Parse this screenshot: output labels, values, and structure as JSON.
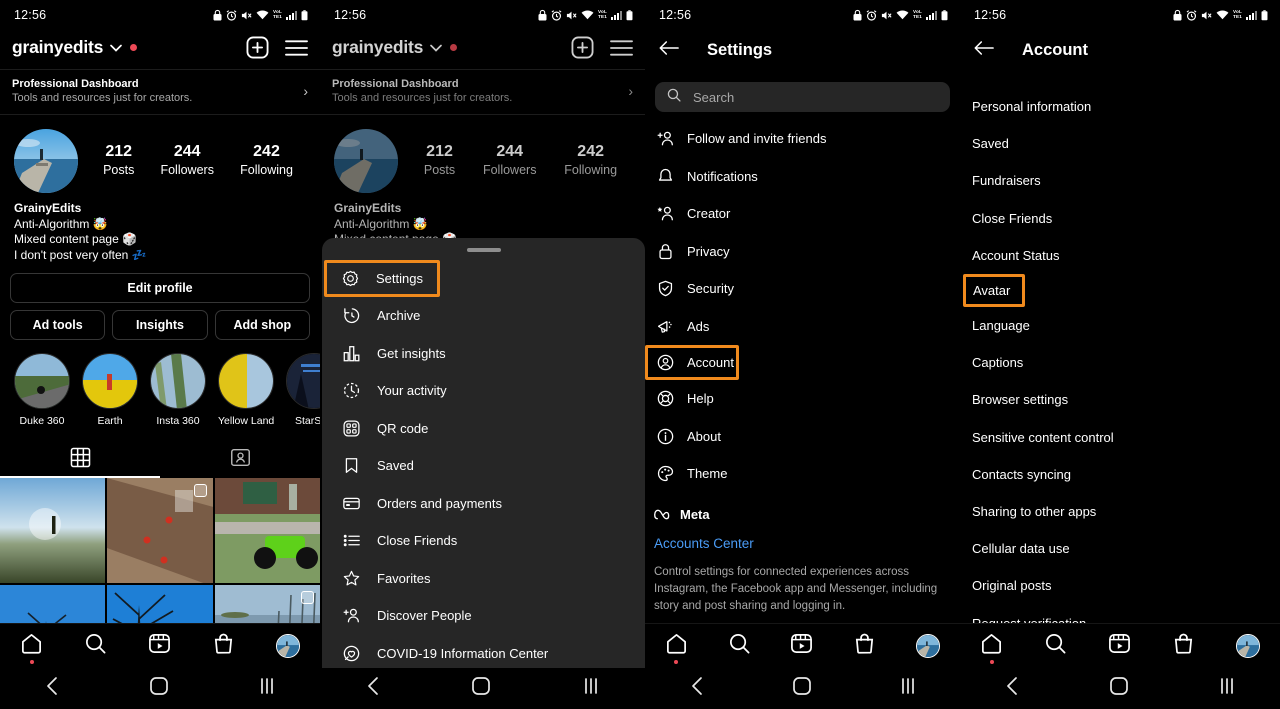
{
  "status_bar": {
    "time": "12:56",
    "icons": [
      "lock-icon",
      "alarm-icon",
      "mute-icon",
      "wifi-icon",
      "volte-icon",
      "signal-icon",
      "battery-icon"
    ],
    "volte_label": "VoLTE1"
  },
  "colors": {
    "highlight_orange": "#F08A1D",
    "link_blue": "#4A9CF6",
    "badge_red": "#ED4956",
    "drawer_bg": "#262626",
    "page_bg": "#000000"
  },
  "profile": {
    "username": "grainyedits",
    "pro_dashboard": {
      "title": "Professional Dashboard",
      "subtitle": "Tools and resources just for creators."
    },
    "stats": [
      {
        "value": "212",
        "label": "Posts"
      },
      {
        "value": "244",
        "label": "Followers"
      },
      {
        "value": "242",
        "label": "Following"
      }
    ],
    "bio": {
      "name": "GrainyEdits",
      "line1": "Anti-Algorithm 🤯",
      "line2": "Mixed content page 🎲",
      "line3": "I don't post very often 💤"
    },
    "buttons": {
      "edit_profile": "Edit profile",
      "ad_tools": "Ad tools",
      "insights": "Insights",
      "add_shop": "Add shop"
    },
    "highlights": [
      {
        "label": "Duke 360"
      },
      {
        "label": "Earth"
      },
      {
        "label": "Insta 360"
      },
      {
        "label": "Yellow Land"
      },
      {
        "label": "StarSha"
      }
    ],
    "tabs": [
      {
        "icon": "grid-icon",
        "active": true
      },
      {
        "icon": "tagged-icon",
        "active": false
      }
    ]
  },
  "drawer": {
    "items": [
      {
        "label": "Settings",
        "icon": "settings-gear-icon",
        "highlighted": true
      },
      {
        "label": "Archive",
        "icon": "archive-clock-icon",
        "highlighted": false
      },
      {
        "label": "Get insights",
        "icon": "bar-chart-icon",
        "highlighted": false
      },
      {
        "label": "Your activity",
        "icon": "activity-clock-icon",
        "highlighted": false
      },
      {
        "label": "QR code",
        "icon": "qr-code-icon",
        "highlighted": false
      },
      {
        "label": "Saved",
        "icon": "bookmark-icon",
        "highlighted": false
      },
      {
        "label": "Orders and payments",
        "icon": "card-icon",
        "highlighted": false
      },
      {
        "label": "Close Friends",
        "icon": "list-icon",
        "highlighted": false
      },
      {
        "label": "Favorites",
        "icon": "star-icon",
        "highlighted": false
      },
      {
        "label": "Discover People",
        "icon": "add-person-icon",
        "highlighted": false
      },
      {
        "label": "COVID-19 Information Center",
        "icon": "covid-heart-icon",
        "highlighted": false
      }
    ]
  },
  "settings": {
    "title": "Settings",
    "search_placeholder": "Search",
    "items": [
      {
        "label": "Follow and invite friends",
        "icon": "add-person-icon",
        "highlighted": false
      },
      {
        "label": "Notifications",
        "icon": "bell-icon",
        "highlighted": false
      },
      {
        "label": "Creator",
        "icon": "star-person-icon",
        "highlighted": false
      },
      {
        "label": "Privacy",
        "icon": "lock-icon",
        "highlighted": false
      },
      {
        "label": "Security",
        "icon": "shield-check-icon",
        "highlighted": false
      },
      {
        "label": "Ads",
        "icon": "megaphone-icon",
        "highlighted": false
      },
      {
        "label": "Account",
        "icon": "account-circle-icon",
        "highlighted": true
      },
      {
        "label": "Help",
        "icon": "lifebuoy-icon",
        "highlighted": false
      },
      {
        "label": "About",
        "icon": "info-icon",
        "highlighted": false
      },
      {
        "label": "Theme",
        "icon": "palette-icon",
        "highlighted": false
      }
    ],
    "meta": {
      "brand": "Meta",
      "link": "Accounts Center",
      "description": "Control settings for connected experiences across Instagram, the Facebook app and Messenger, including story and post sharing and logging in."
    }
  },
  "account": {
    "title": "Account",
    "items": [
      {
        "label": "Personal information",
        "highlighted": false
      },
      {
        "label": "Saved",
        "highlighted": false
      },
      {
        "label": "Fundraisers",
        "highlighted": false
      },
      {
        "label": "Close Friends",
        "highlighted": false
      },
      {
        "label": "Account Status",
        "highlighted": false
      },
      {
        "label": "Avatar",
        "highlighted": true
      },
      {
        "label": "Language",
        "highlighted": false
      },
      {
        "label": "Captions",
        "highlighted": false
      },
      {
        "label": "Browser settings",
        "highlighted": false
      },
      {
        "label": "Sensitive content control",
        "highlighted": false
      },
      {
        "label": "Contacts syncing",
        "highlighted": false
      },
      {
        "label": "Sharing to other apps",
        "highlighted": false
      },
      {
        "label": "Cellular data use",
        "highlighted": false
      },
      {
        "label": "Original posts",
        "highlighted": false
      },
      {
        "label": "Request verification",
        "highlighted": false
      }
    ]
  },
  "bottom_nav": {
    "items": [
      "home-icon",
      "search-icon",
      "reels-icon",
      "shop-icon",
      "profile-avatar"
    ]
  },
  "system_nav": {
    "items": [
      "back-icon",
      "home-icon",
      "recents-icon"
    ]
  }
}
